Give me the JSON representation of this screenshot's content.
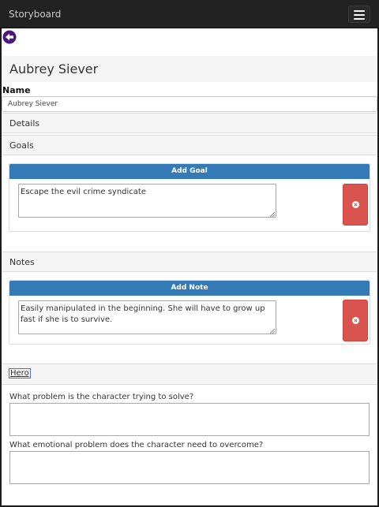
{
  "navbar": {
    "brand": "Storyboard",
    "menu_icon": "hamburger-menu-icon"
  },
  "back_icon": "arrow-left-circle-icon",
  "character": {
    "title": "Aubrey Siever",
    "name_label": "Name",
    "name_value": "Aubrey Siever"
  },
  "sections": {
    "details": "Details",
    "goals": "Goals",
    "notes": "Notes"
  },
  "goals": {
    "add_label": "Add Goal",
    "items": [
      {
        "text": "Escape the evil crime syndicate"
      }
    ]
  },
  "notes": {
    "add_label": "Add Note",
    "items": [
      {
        "text": "Easily manipulated in the beginning. She will have to grow up fast if she is to survive."
      }
    ]
  },
  "hero": {
    "tab_label": "Hero",
    "q1": "What problem is the character trying to solve?",
    "q2": "What emotional problem does the character need to overcome?"
  },
  "colors": {
    "navbar": "#222222",
    "primary": "#337ab7",
    "danger": "#d9534f",
    "back_icon": "#4a1a7a"
  }
}
